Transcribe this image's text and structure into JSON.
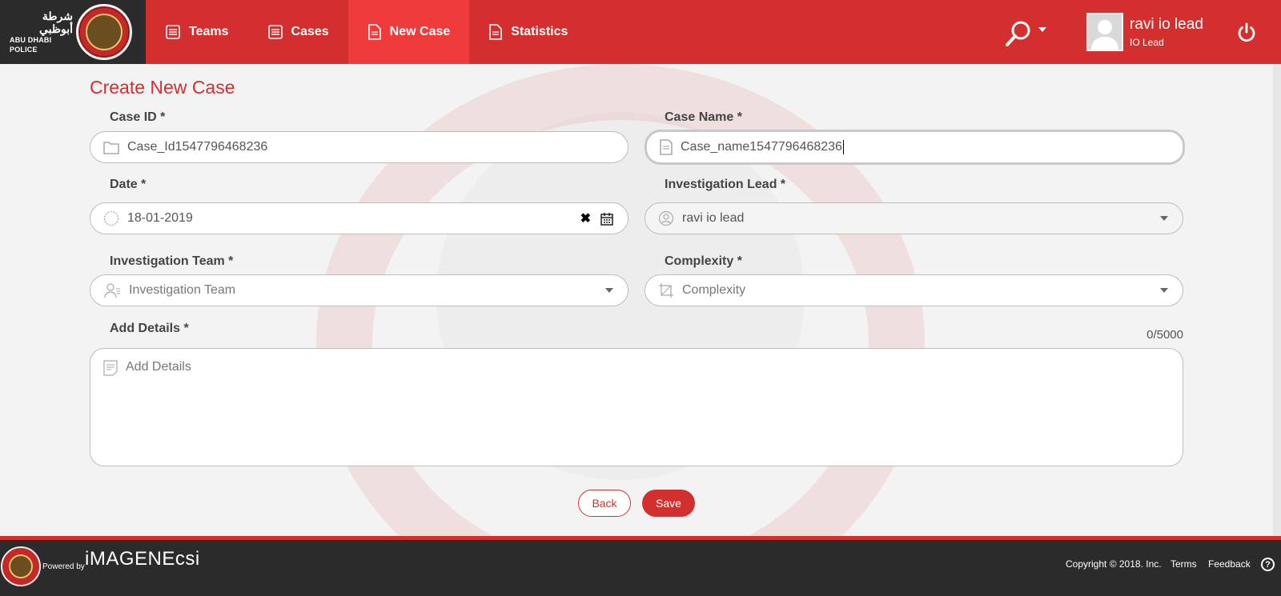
{
  "brand": {
    "arabic": "شرطة أبوظبي",
    "english": "ABU DHABI POLICE"
  },
  "nav": {
    "teams": "Teams",
    "cases": "Cases",
    "new_case": "New Case",
    "statistics": "Statistics"
  },
  "user": {
    "name": "ravi io lead",
    "role": "IO Lead"
  },
  "page": {
    "title": "Create New Case"
  },
  "form": {
    "case_id": {
      "label": "Case ID *",
      "value": "Case_Id1547796468236"
    },
    "case_name": {
      "label": "Case Name *",
      "value": "Case_name1547796468236"
    },
    "date": {
      "label": "Date *",
      "value": "18-01-2019"
    },
    "investigation_lead": {
      "label": "Investigation Lead *",
      "value": "ravi io lead"
    },
    "investigation_team": {
      "label": "Investigation Team *",
      "placeholder": "Investigation Team"
    },
    "complexity": {
      "label": "Complexity *",
      "placeholder": "Complexity"
    },
    "details": {
      "label": "Add Details *",
      "placeholder": "Add Details",
      "counter": "0/5000"
    }
  },
  "buttons": {
    "back": "Back",
    "save": "Save"
  },
  "footer": {
    "powered_by": "Powered by",
    "brand": "iMAGENEcsi",
    "copyright": "Copyright © 2018. Inc.",
    "terms": "Terms",
    "feedback": "Feedback",
    "help": "?"
  },
  "colors": {
    "primary": "#d32f2f",
    "active_tab": "#ef3b3b",
    "dark": "#2b2b2b"
  }
}
